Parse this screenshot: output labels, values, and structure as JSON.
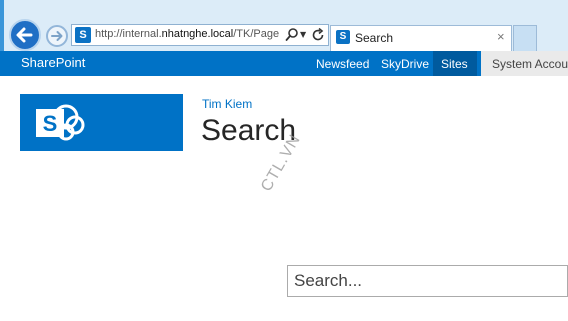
{
  "browser": {
    "address_url_prefix": "http://internal.",
    "address_url_domain": "nhatnghe.local",
    "address_url_suffix": "/TK/Page",
    "tab_title": "Search",
    "tab_close": "×",
    "favicon_letter": "S"
  },
  "suite_bar": {
    "brand": "SharePoint",
    "nav": {
      "newsfeed": "Newsfeed",
      "skydrive": "SkyDrive",
      "sites": "Sites"
    },
    "user": "System Account",
    "color": "#0072c6"
  },
  "page": {
    "breadcrumb": "Tim Kiem",
    "title": "Search",
    "watermark": "CTL.VN",
    "search_placeholder": "Search..."
  },
  "icons": [
    "back-arrow-icon",
    "forward-arrow-icon",
    "sharepoint-favicon-icon",
    "search-icon",
    "dropdown-icon",
    "refresh-icon",
    "close-icon",
    "sharepoint-logo-icon"
  ]
}
